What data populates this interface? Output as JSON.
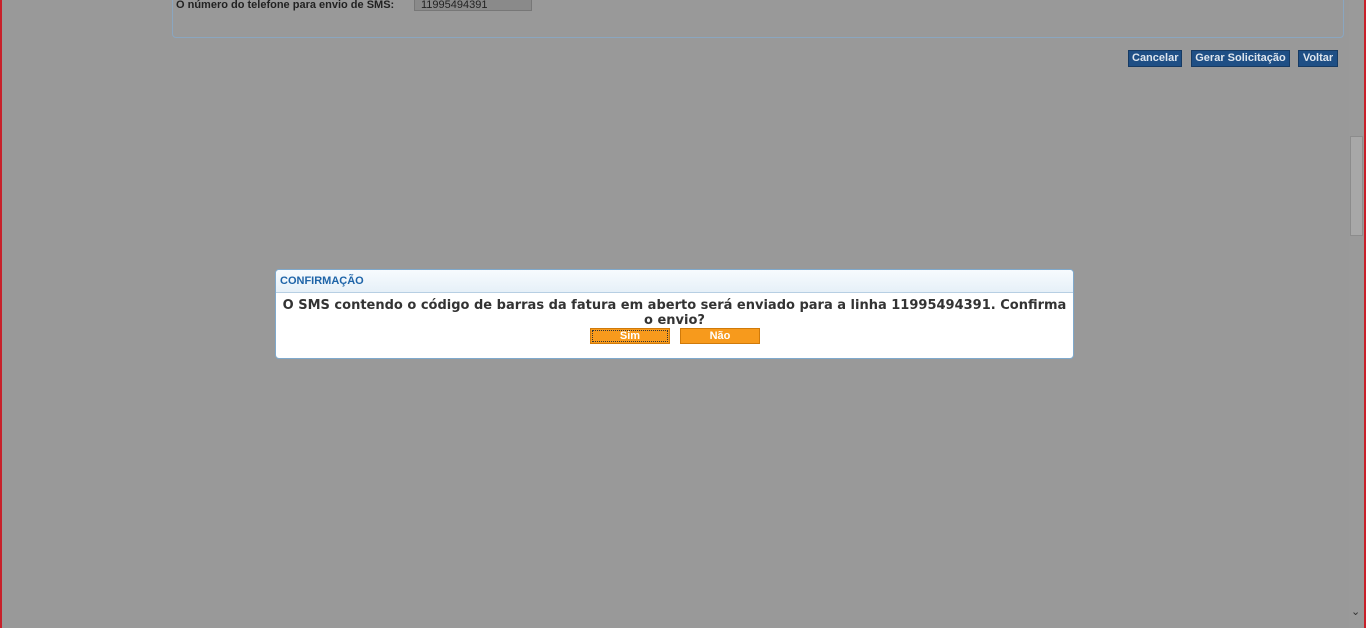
{
  "form": {
    "sms_label": "O número do telefone para envio de SMS:",
    "sms_value": "11995494391"
  },
  "actions": {
    "cancel_label": "Cancelar",
    "generate_label": "Gerar Solicitação",
    "back_label": "Voltar"
  },
  "dialog": {
    "title": "CONFIRMAÇÃO",
    "message": "O SMS contendo o código de barras da fatura em aberto será enviado para a linha 11995494391. Confirma o envio?",
    "yes_label": "Sim",
    "no_label": "Não"
  },
  "scrollbar": {
    "down_arrow": "⌄"
  },
  "colors": {
    "overlay": "#999999",
    "action_button": "#1f4f85",
    "dialog_button": "#f79a1c",
    "dialog_title": "#1e64a8",
    "frame_border": "#c8202a"
  }
}
